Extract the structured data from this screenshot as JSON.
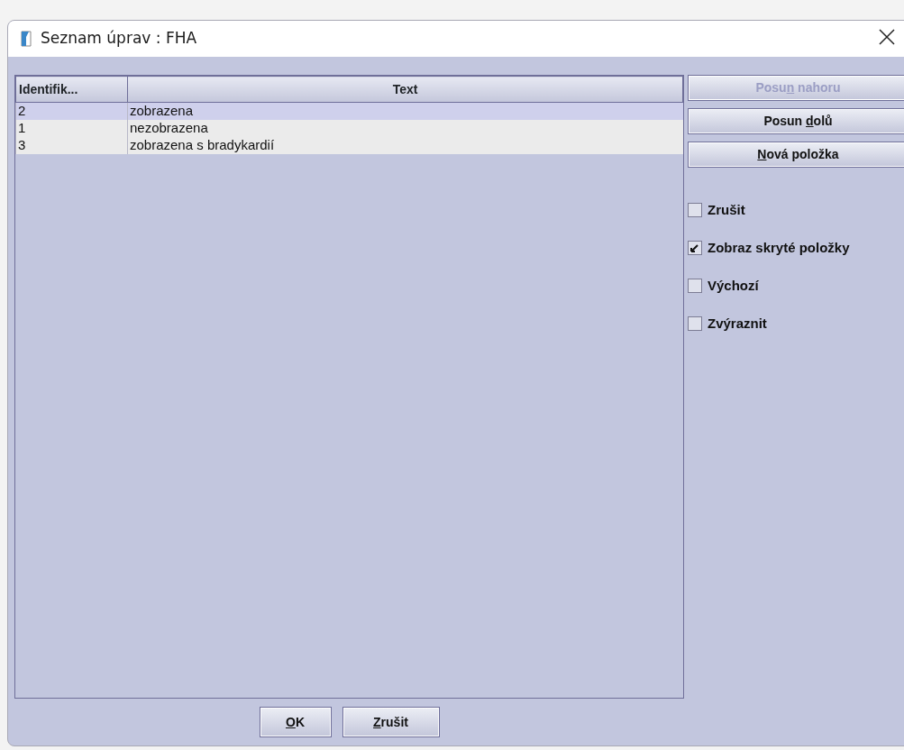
{
  "window": {
    "title": "Seznam úprav : FHA"
  },
  "table": {
    "columns": [
      "Identifik...",
      "Text"
    ],
    "rows": [
      {
        "cells": [
          "2",
          "zobrazena"
        ],
        "selected": true
      },
      {
        "cells": [
          "1",
          "nezobrazena"
        ],
        "selected": false
      },
      {
        "cells": [
          "3",
          "zobrazena s bradykardií"
        ],
        "selected": false
      }
    ]
  },
  "side_buttons": [
    {
      "label": {
        "before": "Posu",
        "key": "n",
        "after": " nahoru"
      },
      "disabled": true
    },
    {
      "label": {
        "before": "Posun ",
        "key": "d",
        "after": "olů"
      },
      "disabled": false
    },
    {
      "label": {
        "key": "N",
        "after": "ová položka"
      },
      "disabled": false
    }
  ],
  "checkboxes": [
    {
      "label": "Zrušit",
      "checked": false
    },
    {
      "label": "Zobraz skryté položky",
      "checked": true
    },
    {
      "label": "Výchozí",
      "checked": false
    },
    {
      "label": "Zvýraznit",
      "checked": false
    }
  ],
  "buttons": [
    {
      "label": {
        "key": "O",
        "after": "K"
      }
    },
    {
      "label": {
        "key": "Z",
        "after": "rušit"
      }
    }
  ]
}
